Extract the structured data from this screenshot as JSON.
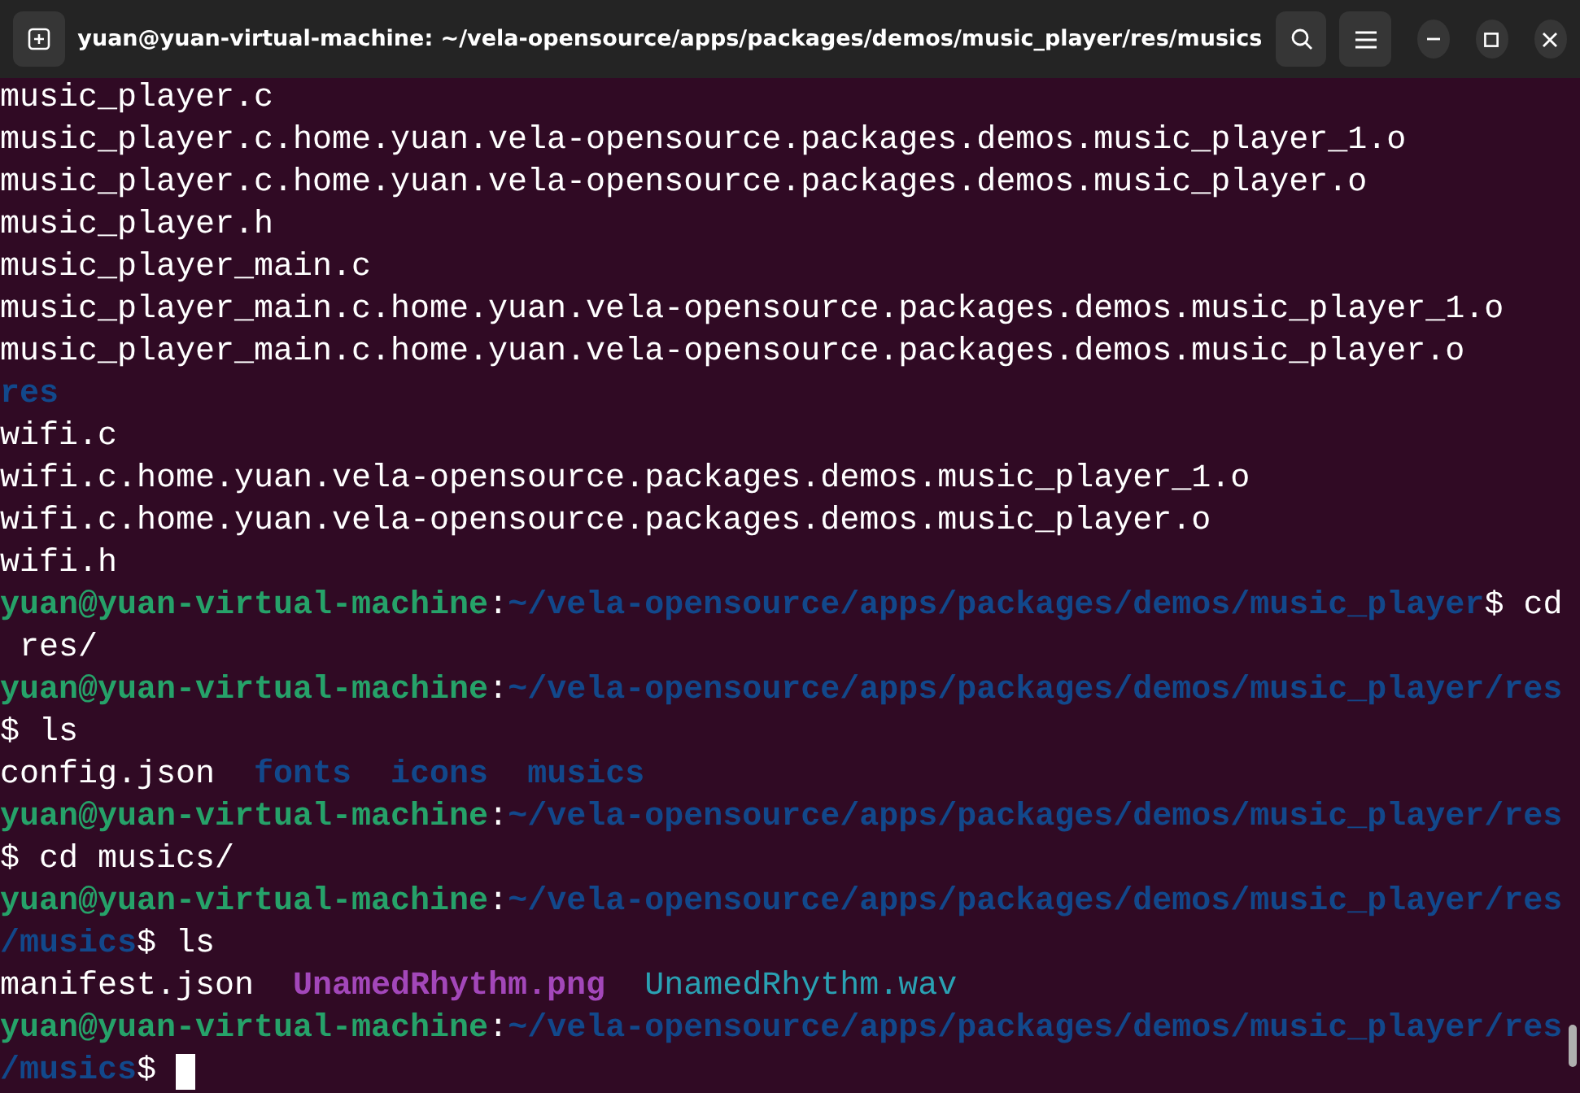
{
  "window": {
    "title": "yuan@yuan-virtual-machine: ~/vela-opensource/apps/packages/demos/music_player/res/musics"
  },
  "lines": [
    [
      {
        "kind": "text",
        "text": "music_player.c"
      }
    ],
    [
      {
        "kind": "text",
        "text": "music_player.c.home.yuan.vela-opensource.packages.demos.music_player_1.o"
      }
    ],
    [
      {
        "kind": "text",
        "text": "music_player.c.home.yuan.vela-opensource.packages.demos.music_player.o"
      }
    ],
    [
      {
        "kind": "text",
        "text": "music_player.h"
      }
    ],
    [
      {
        "kind": "text",
        "text": "music_player_main.c"
      }
    ],
    [
      {
        "kind": "text",
        "text": "music_player_main.c.home.yuan.vela-opensource.packages.demos.music_player_1.o"
      }
    ],
    [
      {
        "kind": "text",
        "text": "music_player_main.c.home.yuan.vela-opensource.packages.demos.music_player.o"
      }
    ],
    [
      {
        "kind": "dir",
        "text": "res"
      }
    ],
    [
      {
        "kind": "text",
        "text": "wifi.c"
      }
    ],
    [
      {
        "kind": "text",
        "text": "wifi.c.home.yuan.vela-opensource.packages.demos.music_player_1.o"
      }
    ],
    [
      {
        "kind": "text",
        "text": "wifi.c.home.yuan.vela-opensource.packages.demos.music_player.o"
      }
    ],
    [
      {
        "kind": "text",
        "text": "wifi.h"
      }
    ],
    [
      {
        "kind": "user",
        "text": "yuan@yuan-virtual-machine"
      },
      {
        "kind": "command",
        "text": ":"
      },
      {
        "kind": "path",
        "text": "~/vela-opensource/apps/packages/demos/music_player"
      },
      {
        "kind": "command",
        "text": "$ cd"
      }
    ],
    [
      {
        "kind": "command",
        "text": " res/"
      }
    ],
    [
      {
        "kind": "user",
        "text": "yuan@yuan-virtual-machine"
      },
      {
        "kind": "command",
        "text": ":"
      },
      {
        "kind": "path",
        "text": "~/vela-opensource/apps/packages/demos/music_player/res"
      }
    ],
    [
      {
        "kind": "command",
        "text": "$ ls"
      }
    ],
    [
      {
        "kind": "text",
        "text": "config.json"
      },
      {
        "kind": "dir",
        "text": "fonts"
      },
      {
        "kind": "dir",
        "text": "icons"
      },
      {
        "kind": "dir",
        "text": "musics"
      }
    ],
    [
      {
        "kind": "user",
        "text": "yuan@yuan-virtual-machine"
      },
      {
        "kind": "command",
        "text": ":"
      },
      {
        "kind": "path",
        "text": "~/vela-opensource/apps/packages/demos/music_player/res"
      }
    ],
    [
      {
        "kind": "command",
        "text": "$ cd musics/"
      }
    ],
    [
      {
        "kind": "user",
        "text": "yuan@yuan-virtual-machine"
      },
      {
        "kind": "command",
        "text": ":"
      },
      {
        "kind": "path",
        "text": "~/vela-opensource/apps/packages/demos/music_player/res"
      }
    ],
    [
      {
        "kind": "path",
        "text": "/musics"
      },
      {
        "kind": "command",
        "text": "$ ls"
      }
    ],
    [
      {
        "kind": "text",
        "text": "manifest.json"
      },
      {
        "kind": "image",
        "text": "UnamedRhythm.png"
      },
      {
        "kind": "audio",
        "text": "UnamedRhythm.wav"
      }
    ],
    [
      {
        "kind": "user",
        "text": "yuan@yuan-virtual-machine"
      },
      {
        "kind": "command",
        "text": ":"
      },
      {
        "kind": "path",
        "text": "~/vela-opensource/apps/packages/demos/music_player/res"
      }
    ],
    [
      {
        "kind": "path",
        "text": "/musics"
      },
      {
        "kind": "command",
        "text": "$"
      },
      {
        "kind": "cursor"
      }
    ]
  ]
}
